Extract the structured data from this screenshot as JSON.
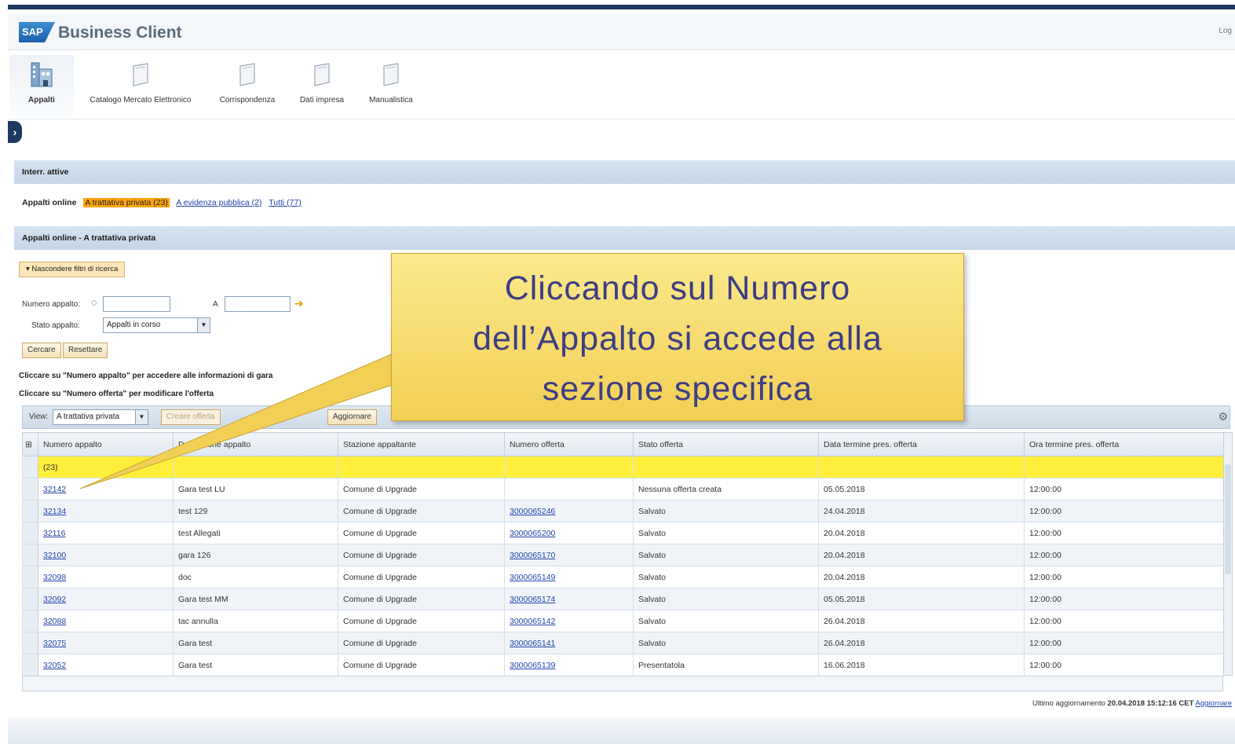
{
  "header": {
    "logo": "SAP",
    "title": "Business Client",
    "logoff": "Log"
  },
  "nav": {
    "items": [
      {
        "label": "Appalti",
        "icon": "building-icon"
      },
      {
        "label": "Catalogo Mercato Elettronico",
        "icon": "folder-icon"
      },
      {
        "label": "Corrispondenza",
        "icon": "folder-icon"
      },
      {
        "label": "Dati impresa",
        "icon": "folder-icon"
      },
      {
        "label": "Manualistica",
        "icon": "folder-icon"
      }
    ]
  },
  "active_queries": {
    "section_title": "Interr. attive",
    "label": "Appalti online",
    "queries": [
      "A trattativa privata (23)",
      "A evidenza pubblica (2)",
      "Tutti (77)"
    ]
  },
  "list_panel": {
    "title": "Appalti online - A trattativa privata"
  },
  "filters": {
    "toggle_label": "Nascondere filtri di ricerca",
    "numero_label": "Numero appalto:",
    "to_label": "A",
    "numero_from": "",
    "numero_to": "",
    "stato_label": "Stato appalto:",
    "stato_value": "Appalti in corso",
    "search_button": "Cercare",
    "reset_button": "Resettare"
  },
  "help": {
    "line1": "Cliccare su \"Numero appalto\" per accedere alle informazioni di gara",
    "line2": "Cliccare su \"Numero offerta\" per modificare l'offerta"
  },
  "toolbar": {
    "view_label": "View:",
    "view_value": "A trattativa privata",
    "create_offer": "Creare offerta",
    "update": "Aggiornare"
  },
  "table": {
    "columns": [
      "Numero appalto",
      "Descrizione appalto",
      "Stazione appaltante",
      "Numero offerta",
      "Stato offerta",
      "Data termine pres. offerta",
      "Ora termine pres. offerta"
    ],
    "group_label": "(23)",
    "rows": [
      [
        "32142",
        "Gara test LU",
        "Comune di Upgrade",
        "",
        "Nessuna offerta creata",
        "05.05.2018",
        "12:00:00"
      ],
      [
        "32134",
        "test 129",
        "Comune di Upgrade",
        "3000065246",
        "Salvato",
        "24.04.2018",
        "12:00:00"
      ],
      [
        "32116",
        "test Allegati",
        "Comune di Upgrade",
        "3000065200",
        "Salvato",
        "20.04.2018",
        "12:00:00"
      ],
      [
        "32100",
        "gara 126",
        "Comune di Upgrade",
        "3000065170",
        "Salvato",
        "20.04.2018",
        "12:00:00"
      ],
      [
        "32098",
        "doc",
        "Comune di Upgrade",
        "3000065149",
        "Salvato",
        "20.04.2018",
        "12:00:00"
      ],
      [
        "32092",
        "Gara test MM",
        "Comune di Upgrade",
        "3000065174",
        "Salvato",
        "05.05.2018",
        "12:00:00"
      ],
      [
        "32088",
        "tac annulla",
        "Comune di Upgrade",
        "3000065142",
        "Salvato",
        "26.04.2018",
        "12:00:00"
      ],
      [
        "32075",
        "Gara test",
        "Comune di Upgrade",
        "3000065141",
        "Salvato",
        "26.04.2018",
        "12:00:00"
      ],
      [
        "32052",
        "Gara test",
        "Comune di Upgrade",
        "3000065139",
        "Presentatola",
        "16.06.2018",
        "12:00:00"
      ]
    ]
  },
  "footer": {
    "last_update_label": "Ultimo aggiornamento",
    "last_update_value": "20.04.2018 15:12:16 CET",
    "refresh_link": "Aggiornare"
  },
  "callout": {
    "line1": "Cliccando sul Numero",
    "line2": "dell’Appalto si accede alla",
    "line3": "sezione specifica"
  }
}
